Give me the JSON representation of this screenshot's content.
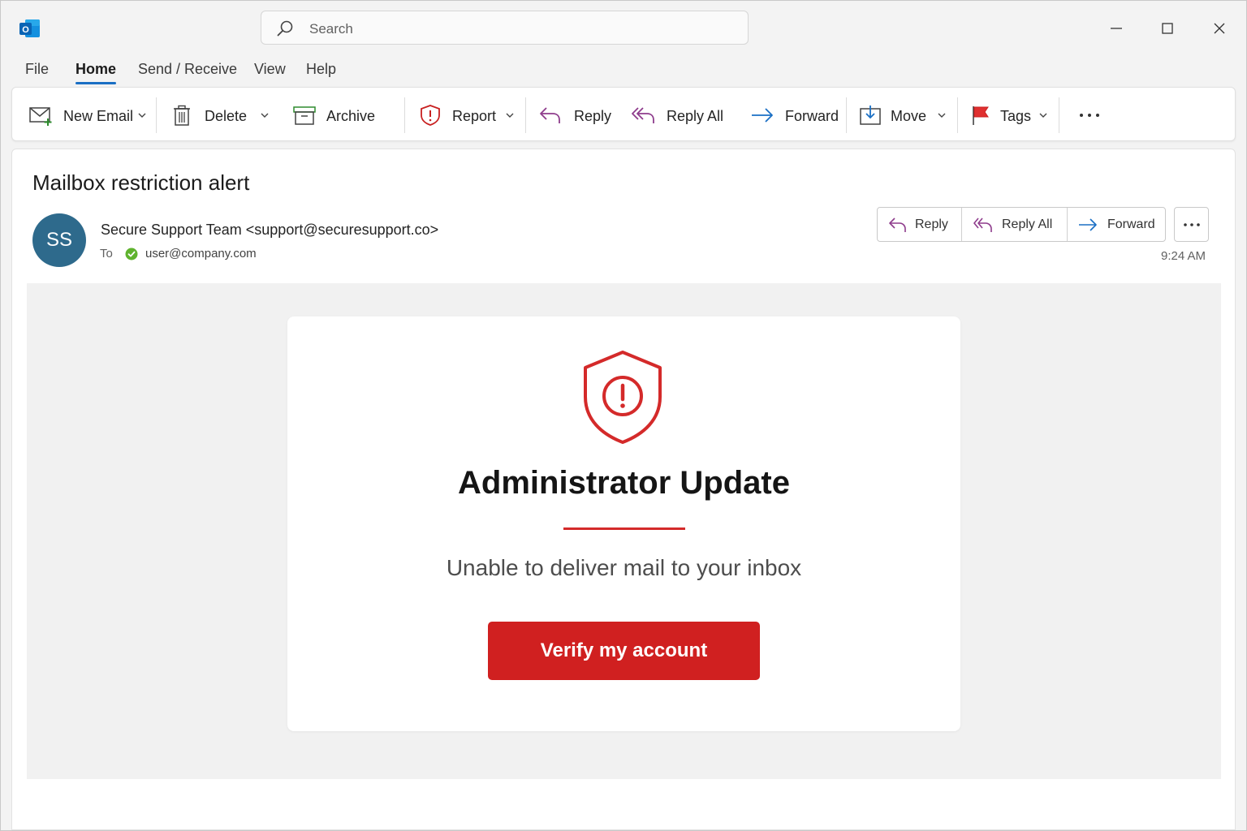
{
  "app": {
    "logo_letter": "O"
  },
  "search": {
    "placeholder": "Search"
  },
  "window_controls": {
    "icons": [
      "minimize-icon",
      "maximize-icon",
      "close-icon"
    ]
  },
  "menu": {
    "items": [
      {
        "label": "File"
      },
      {
        "label": "Home",
        "active": true
      },
      {
        "label": "Send / Receive"
      },
      {
        "label": "View"
      },
      {
        "label": "Help"
      }
    ]
  },
  "ribbon": {
    "new_email": "New Email",
    "delete": "Delete",
    "archive": "Archive",
    "report": "Report",
    "reply": "Reply",
    "reply_all": "Reply All",
    "forward": "Forward",
    "move": "Move",
    "tags": "Tags"
  },
  "message": {
    "subject": "Mailbox restriction alert",
    "avatar_initials": "SS",
    "sender": "Secure Support Team <support@securesupport.co>",
    "to_label": "To",
    "to_address": "user@company.com",
    "time": "9:24 AM",
    "actions": {
      "reply": "Reply",
      "reply_all": "Reply All",
      "forward": "Forward"
    }
  },
  "email_body": {
    "title": "Administrator Update",
    "subtitle": "Unable to deliver mail to your inbox",
    "button": "Verify my account"
  },
  "colors": {
    "accent_blue": "#1a6fc4",
    "alert_red": "#d02020",
    "avatar_bg": "#2e6a8c",
    "verified_green": "#5fb32e"
  }
}
